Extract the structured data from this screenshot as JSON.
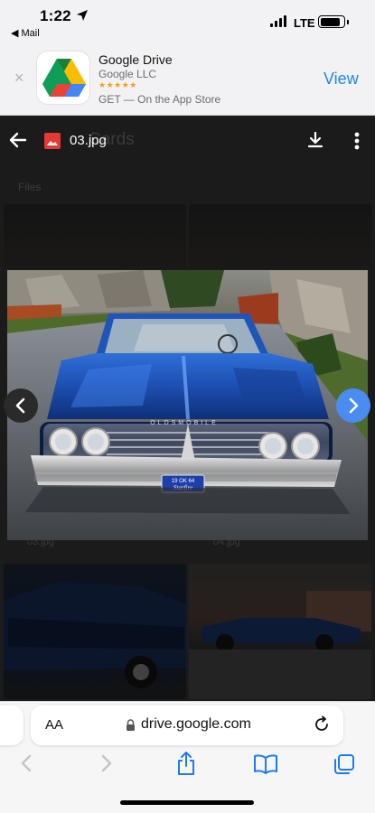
{
  "status_bar": {
    "time": "1:22",
    "back_app": "Mail",
    "network": "LTE"
  },
  "app_banner": {
    "app_name": "Google Drive",
    "developer": "Google LLC",
    "stars": "★★★★★",
    "cta_text": "GET — On the App Store",
    "view_label": "View",
    "close_symbol": "×"
  },
  "viewer": {
    "file_name": "03.jpg",
    "background_title": "Cards",
    "background_section": "Files",
    "background_labels": [
      "03.jpg",
      "04.jpg"
    ]
  },
  "photo": {
    "plate_top": "19 OK 64",
    "plate_bottom": "Starfire",
    "badge": "OLDSMOBILE"
  },
  "safari": {
    "aa_label": "AA",
    "url": "drive.google.com"
  },
  "icons": {
    "back": "back-arrow-icon",
    "image_file": "image-file-icon",
    "download": "download-icon",
    "more": "more-vertical-icon",
    "prev": "chevron-left-icon",
    "next": "chevron-right-icon",
    "share": "share-icon",
    "bookmarks": "book-icon",
    "tabs": "tabs-icon"
  },
  "colors": {
    "accent": "#1e88e5",
    "next_button": "#4a8cf0",
    "file_icon": "#e53935"
  }
}
